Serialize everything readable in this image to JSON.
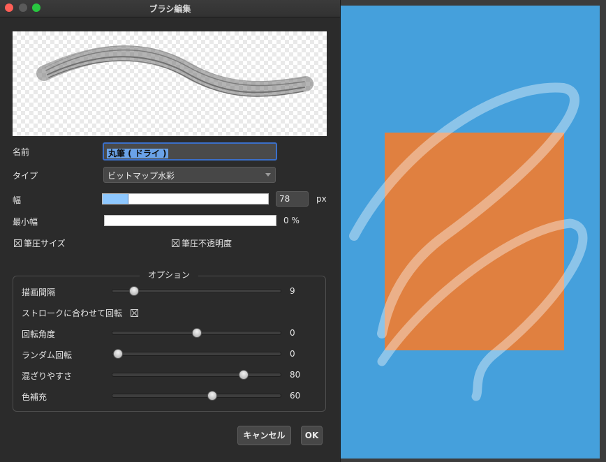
{
  "window": {
    "title": "ブラシ編集"
  },
  "fields": {
    "name_label": "名前",
    "name_value": "丸筆 ( ドライ )",
    "type_label": "タイプ",
    "type_value": "ビットマップ水彩",
    "width_label": "幅",
    "width_value": "78",
    "width_unit": "px",
    "width_fraction": 0.15,
    "min_width_label": "最小幅",
    "min_width_value": "0 %",
    "min_width_fraction": 0,
    "pressure_size_label": "筆圧サイズ",
    "pressure_size_checked": true,
    "pressure_opacity_label": "筆圧不透明度",
    "pressure_opacity_checked": true
  },
  "options": {
    "title": "オプション",
    "spacing_label": "描画間隔",
    "spacing_value": "9",
    "spacing_fraction": 0.1,
    "rotate_stroke_label": "ストロークに合わせて回転",
    "rotate_stroke_checked": true,
    "angle_label": "回転角度",
    "angle_value": "0",
    "angle_fraction": 0.5,
    "random_label": "ランダム回転",
    "random_value": "0",
    "random_fraction": 0.0,
    "mix_label": "混ざりやすさ",
    "mix_value": "80",
    "mix_fraction": 0.8,
    "fill_label": "色補充",
    "fill_value": "60",
    "fill_fraction": 0.6
  },
  "buttons": {
    "cancel": "キャンセル",
    "ok": "OK"
  },
  "colors": {
    "canvas": "#45a0dc",
    "shape": "#e08040",
    "accent": "#3b6fc9"
  }
}
